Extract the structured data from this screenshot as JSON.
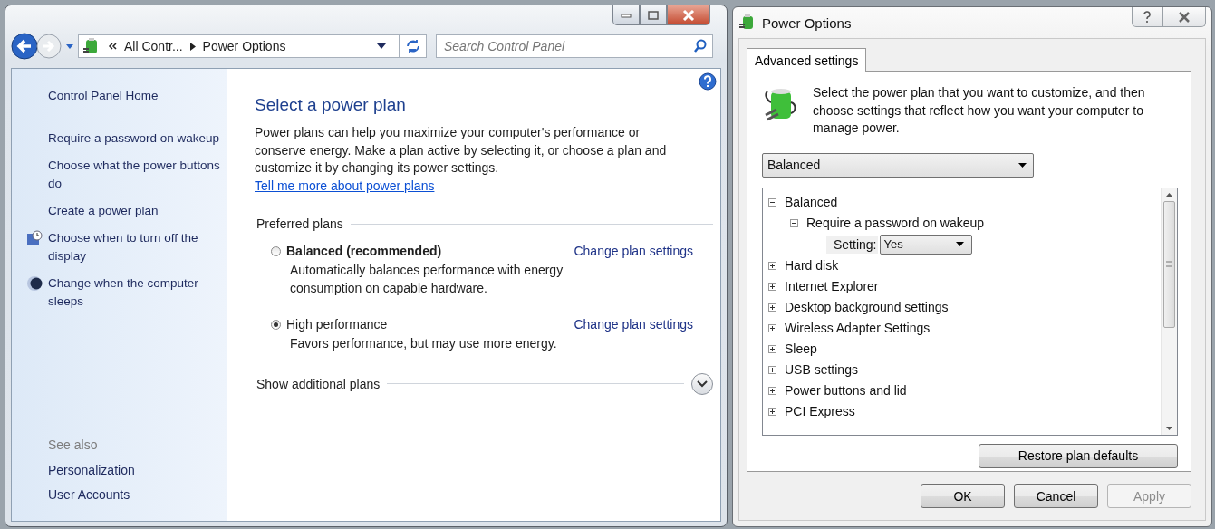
{
  "explorer": {
    "address": {
      "crumbs": [
        "All Contr...",
        "Power Options"
      ]
    },
    "search": {
      "placeholder": "Search Control Panel"
    },
    "sidebar": {
      "items": [
        {
          "label": "Control Panel Home",
          "kind": "home"
        },
        {
          "label": "Require a password on wakeup",
          "kind": "link"
        },
        {
          "label": "Choose what the power buttons do",
          "kind": "link"
        },
        {
          "label": "Create a power plan",
          "kind": "link"
        },
        {
          "label": "Choose when to turn off the display",
          "kind": "display"
        },
        {
          "label": "Change when the computer sleeps",
          "kind": "sleep"
        }
      ],
      "see_also": {
        "heading": "See also",
        "items": [
          "Personalization",
          "User Accounts"
        ]
      }
    },
    "content": {
      "title": "Select a power plan",
      "intro": "Power plans can help you maximize your computer's performance or conserve energy. Make a plan active by selecting it, or choose a plan and customize it by changing its power settings. ",
      "intro_link": "Tell me more about power plans",
      "section": "Preferred plans",
      "plans": [
        {
          "name": "Balanced (recommended)",
          "recommended": true,
          "selected": false,
          "action": "Change plan settings",
          "description": "Automatically balances performance with energy consumption on capable hardware."
        },
        {
          "name": "High performance",
          "recommended": false,
          "selected": true,
          "action": "Change plan settings",
          "description": "Favors performance, but may use more energy."
        }
      ],
      "more": "Show additional plans"
    }
  },
  "dialog": {
    "title": "Power Options",
    "tabs": [
      {
        "label": "Advanced settings",
        "selected": true
      }
    ],
    "description": "Select the power plan that you want to customize, and then choose settings that reflect how you want your computer to manage power.",
    "plan_select": {
      "value": "Balanced"
    },
    "tree": [
      {
        "label": "Balanced",
        "expanded": true,
        "children": [
          {
            "label": "Require a password on wakeup",
            "expanded": true,
            "setting": {
              "label": "Setting:",
              "value": "Yes"
            }
          }
        ]
      },
      {
        "label": "Hard disk",
        "expanded": false
      },
      {
        "label": "Internet Explorer",
        "expanded": false
      },
      {
        "label": "Desktop background settings",
        "expanded": false
      },
      {
        "label": "Wireless Adapter Settings",
        "expanded": false
      },
      {
        "label": "Sleep",
        "expanded": false
      },
      {
        "label": "USB settings",
        "expanded": false
      },
      {
        "label": "Power buttons and lid",
        "expanded": false
      },
      {
        "label": "PCI Express",
        "expanded": false
      }
    ],
    "restore_button": "Restore plan defaults",
    "buttons": [
      {
        "label": "OK",
        "disabled": false
      },
      {
        "label": "Cancel",
        "disabled": false
      },
      {
        "label": "Apply",
        "disabled": true
      }
    ]
  }
}
